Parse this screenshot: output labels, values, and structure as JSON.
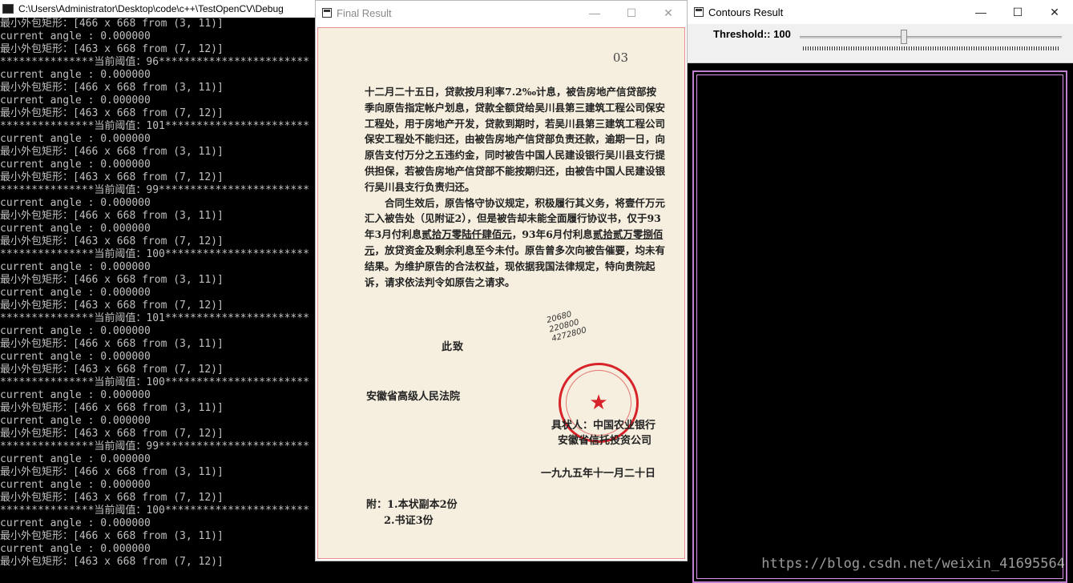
{
  "console": {
    "title": "C:\\Users\\Administrator\\Desktop\\code\\c++\\TestOpenCV\\Debug",
    "lines": [
      "最小外包矩形：[466 x 668 from (3, 11)]",
      "current angle : 0.000000",
      "最小外包矩形：[463 x 668 from (7, 12)]",
      "***************当前阈值：96************************",
      "current angle : 0.000000",
      "最小外包矩形：[466 x 668 from (3, 11)]",
      "current angle : 0.000000",
      "最小外包矩形：[463 x 668 from (7, 12)]",
      "***************当前阈值：101***********************",
      "current angle : 0.000000",
      "最小外包矩形：[466 x 668 from (3, 11)]",
      "current angle : 0.000000",
      "最小外包矩形：[463 x 668 from (7, 12)]",
      "***************当前阈值：99************************",
      "current angle : 0.000000",
      "最小外包矩形：[466 x 668 from (3, 11)]",
      "current angle : 0.000000",
      "最小外包矩形：[463 x 668 from (7, 12)]",
      "***************当前阈值：100***********************",
      "current angle : 0.000000",
      "最小外包矩形：[466 x 668 from (3, 11)]",
      "current angle : 0.000000",
      "最小外包矩形：[463 x 668 from (7, 12)]",
      "***************当前阈值：101***********************",
      "current angle : 0.000000",
      "最小外包矩形：[466 x 668 from (3, 11)]",
      "current angle : 0.000000",
      "最小外包矩形：[463 x 668 from (7, 12)]",
      "***************当前阈值：100***********************",
      "current angle : 0.000000",
      "最小外包矩形：[466 x 668 from (3, 11)]",
      "current angle : 0.000000",
      "最小外包矩形：[463 x 668 from (7, 12)]",
      "***************当前阈值：99************************",
      "current angle : 0.000000",
      "最小外包矩形：[466 x 668 from (3, 11)]",
      "current angle : 0.000000",
      "最小外包矩形：[463 x 668 from (7, 12)]",
      "***************当前阈值：100***********************",
      "current angle : 0.000000",
      "最小外包矩形：[466 x 668 from (3, 11)]",
      "current angle : 0.000000",
      "最小外包矩形：[463 x 668 from (7, 12)]"
    ]
  },
  "final_window": {
    "title": "Final Result",
    "minimize": "—",
    "maximize": "☐",
    "close": "✕",
    "document": {
      "page_number": "03",
      "para1": "十二月二十五日，贷款按月利率7.2‰计息，被告房地产信贷部按季向原告指定帐户划息，贷款全额贷给吴川县第三建筑工程公司保安工程处，用于房地产开发，贷款到期时，若吴川县第三建筑工程公司保安工程处不能归还，由被告房地产信贷部负责还款，逾期一日，向原告支付万分之五违约金，同时被告中国人民建设银行吴川县支行提供担保，若被告房地产信贷部不能按期归还，由被告中国人民建设银行吴川县支行负责归还。",
      "para2_a": "合同生效后，原告恪守协议规定，积极履行其义务，将壹仟万元汇入被告处（见附证2），但是被告却未能全面履行协议书，仅于93年3月付利息",
      "para2_u1": "贰拾万零陆仟肆佰元",
      "para2_b": "，93年6月付利息",
      "para2_u2": "贰拾贰万零捌佰元",
      "para2_c": "，放贷资金及剩余利息至今未付。原告曾多次向被告催要，均未有结果。为维护原告的合法权益，现依据我国法律规定，特向贵院起诉，请求依法判令如原告之请求。",
      "salutation": "此致",
      "handwritten": [
        "20680",
        "220800",
        "4272800"
      ],
      "recipient": "安徽省高级人民法院",
      "seal_symbol": "★",
      "signer_line1": "具状人：中国农业银行",
      "signer_line2": "安徽省信托投资公司",
      "date": "一九九五年十一月二十日",
      "attach_line1": "附：1.本状副本2份",
      "attach_line2": "2.书证3份"
    }
  },
  "contours_window": {
    "title": "Contours Result",
    "minimize": "—",
    "maximize": "☐",
    "close": "✕",
    "trackbar_label": "Threshold:: 100",
    "threshold_value": 100
  },
  "watermark": "https://blog.csdn.net/weixin_41695564"
}
